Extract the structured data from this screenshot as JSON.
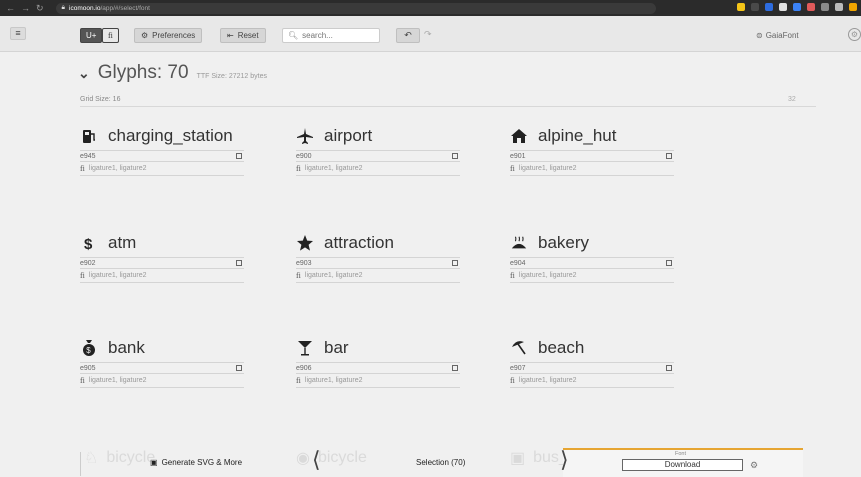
{
  "browser": {
    "url_host": "icomoon.io",
    "url_path": "/app/#/select/font",
    "ext_colors": [
      "#f5c518",
      "#4a4a4a",
      "#2d6cdf",
      "#e0e0e0",
      "#3b82f6",
      "#e05a5a",
      "#8a8a8a",
      "#bbbbbb",
      "#f0a500"
    ]
  },
  "toolbar": {
    "unicode_btn": "U+",
    "lig_btn": "fi",
    "preferences_label": "Preferences",
    "reset_label": "Reset",
    "search_placeholder": "search...",
    "font_name": "GaiaFont"
  },
  "set": {
    "title": "Glyphs: 70",
    "ttf_size": "TTF Size: 27212 bytes",
    "grid_size": "Grid Size: 16",
    "grid_max": "32"
  },
  "glyphs": [
    {
      "name": "charging_station",
      "code": "e945",
      "ligatures": "ligature1, ligature2",
      "icon": "charging-station-icon"
    },
    {
      "name": "airport",
      "code": "e900",
      "ligatures": "ligature1, ligature2",
      "icon": "airplane-icon"
    },
    {
      "name": "alpine_hut",
      "code": "e901",
      "ligatures": "ligature1, ligature2",
      "icon": "hut-icon"
    },
    {
      "name": "atm",
      "code": "e902",
      "ligatures": "ligature1, ligature2",
      "icon": "dollar-icon"
    },
    {
      "name": "attraction",
      "code": "e903",
      "ligatures": "ligature1, ligature2",
      "icon": "star-icon"
    },
    {
      "name": "bakery",
      "code": "e904",
      "ligatures": "ligature1, ligature2",
      "icon": "bread-icon"
    },
    {
      "name": "bank",
      "code": "e905",
      "ligatures": "ligature1, ligature2",
      "icon": "money-bag-icon"
    },
    {
      "name": "bar",
      "code": "e906",
      "ligatures": "ligature1, ligature2",
      "icon": "cocktail-icon"
    },
    {
      "name": "beach",
      "code": "e907",
      "ligatures": "ligature1, ligature2",
      "icon": "umbrella-icon"
    }
  ],
  "next_row": [
    "bicycle",
    "bicycle",
    "bus_station"
  ],
  "bottom": {
    "generate_label": "Generate SVG & More",
    "selection_label": "Selection (70)",
    "font_label": "Font",
    "download_label": "Download"
  },
  "colors": {
    "accent": "#e6a532",
    "background": "#f0f0f0"
  }
}
